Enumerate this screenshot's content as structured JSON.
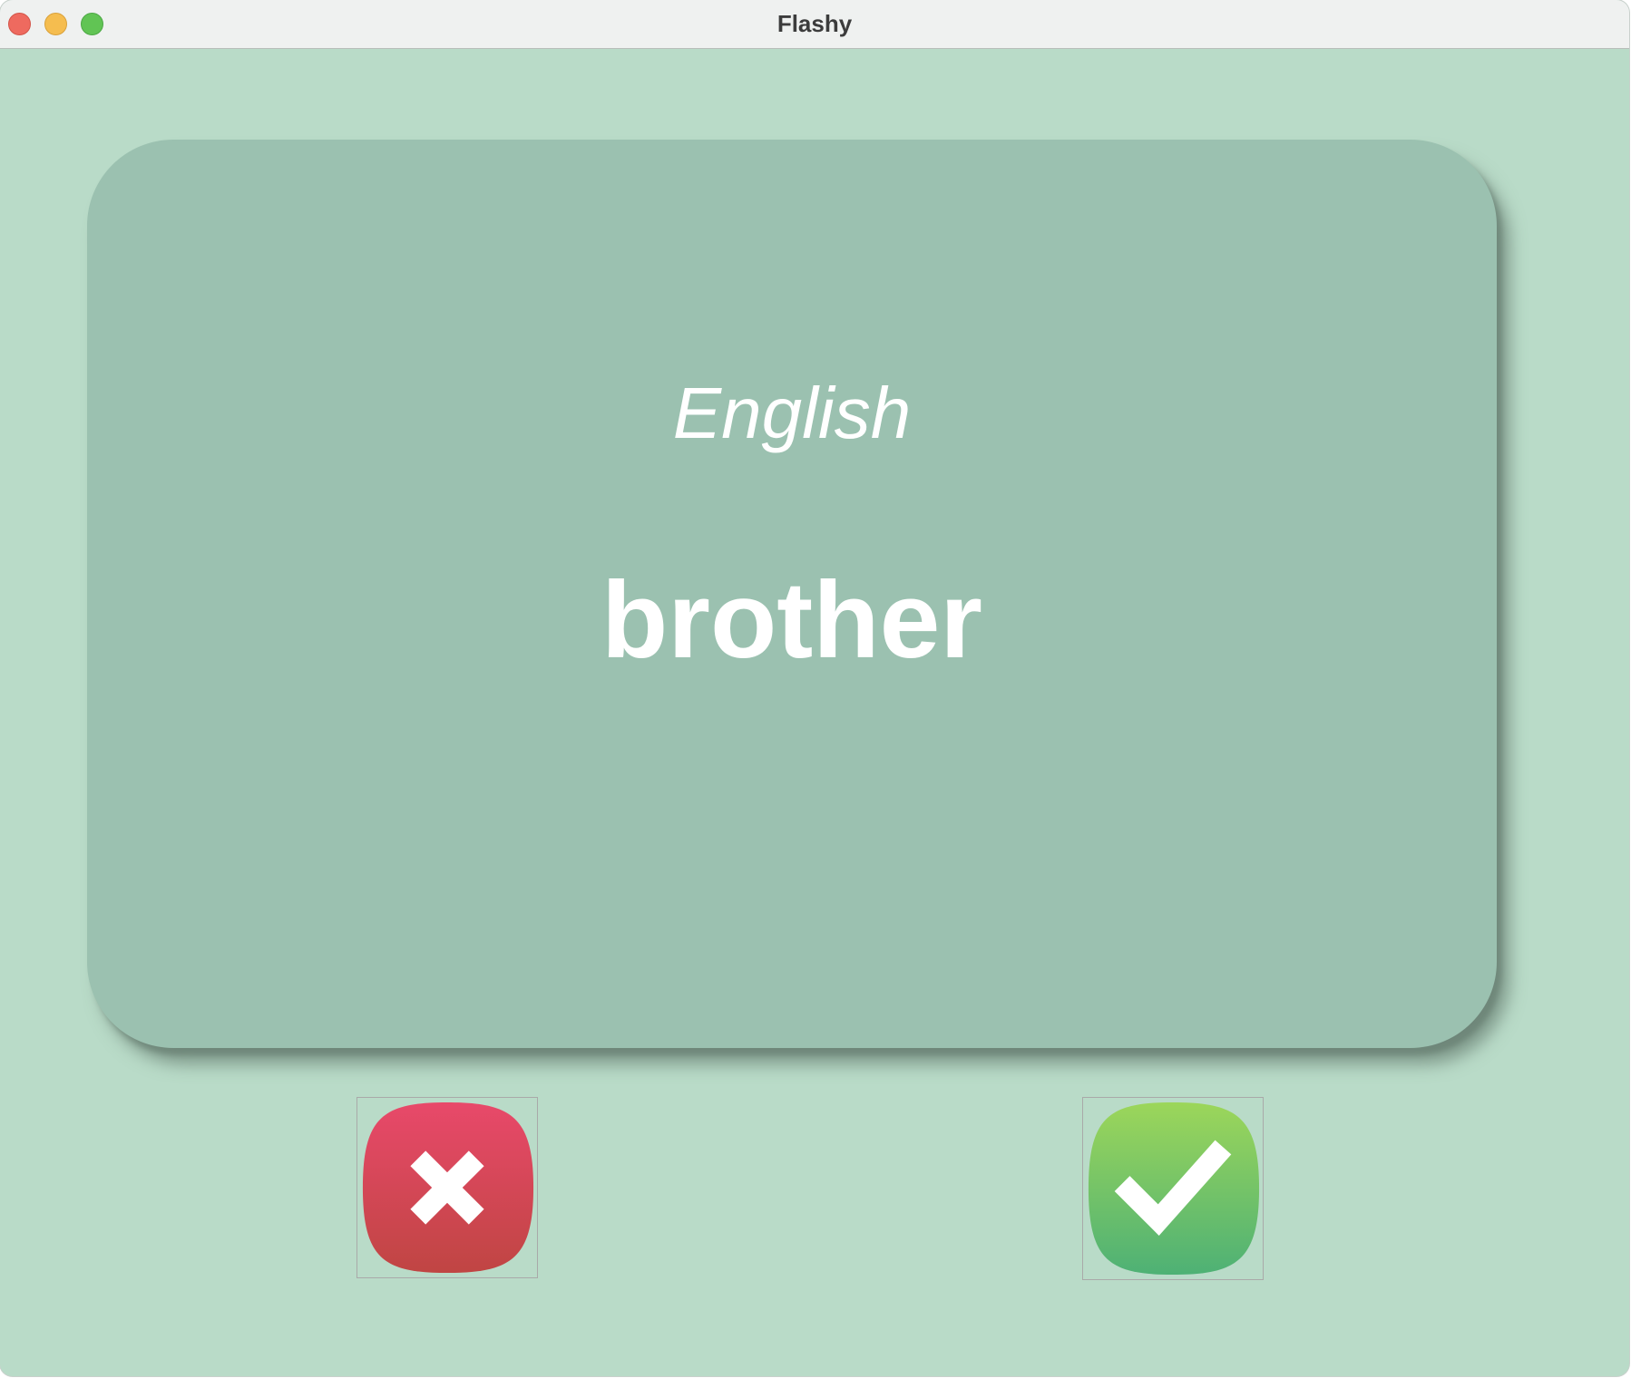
{
  "window": {
    "title": "Flashy"
  },
  "card": {
    "title": "English",
    "word": "brother"
  },
  "buttons": {
    "wrong_icon": "cross-icon",
    "right_icon": "checkmark-icon"
  },
  "colors": {
    "background": "#b9dbc8",
    "card": "#9bc1b0",
    "wrong_top": "#e8496a",
    "wrong_bottom": "#c04543",
    "right_top": "#9cd65a",
    "right_bottom": "#4eb175"
  }
}
